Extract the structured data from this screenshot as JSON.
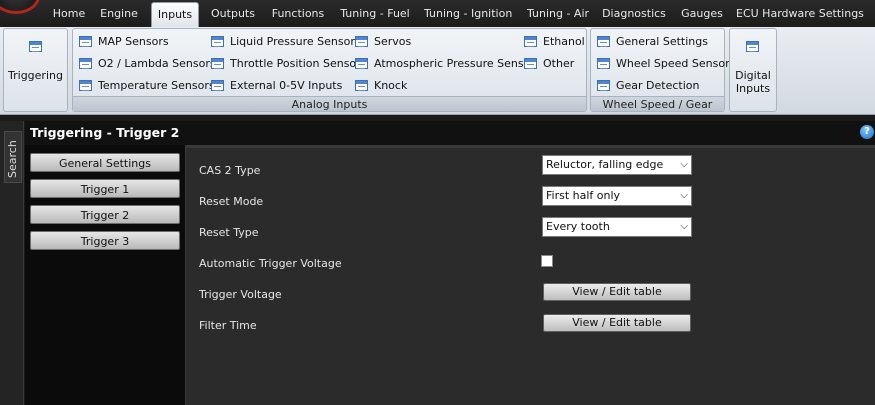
{
  "menu": {
    "tabs": [
      {
        "label": "Home"
      },
      {
        "label": "Engine"
      },
      {
        "label": "Inputs"
      },
      {
        "label": "Outputs"
      },
      {
        "label": "Functions"
      },
      {
        "label": "Tuning - Fuel"
      },
      {
        "label": "Tuning - Ignition"
      },
      {
        "label": "Tuning - Air"
      },
      {
        "label": "Diagnostics"
      },
      {
        "label": "Gauges"
      },
      {
        "label": "ECU Hardware Settings"
      }
    ],
    "active_tab": "Inputs"
  },
  "ribbon": {
    "triggering": {
      "label": "Triggering"
    },
    "analog_inputs": {
      "group_label": "Analog Inputs",
      "items": [
        {
          "label": "MAP Sensors"
        },
        {
          "label": "O2 / Lambda Sensors"
        },
        {
          "label": "Temperature Sensors"
        },
        {
          "label": "Liquid Pressure Sensors"
        },
        {
          "label": "Throttle Position Sensor"
        },
        {
          "label": "External 0-5V Inputs"
        },
        {
          "label": "Servos"
        },
        {
          "label": "Atmospheric Pressure Sensor"
        },
        {
          "label": "Knock"
        },
        {
          "label": "Ethanol"
        },
        {
          "label": "Other"
        }
      ]
    },
    "wheel_speed": {
      "group_label": "Wheel Speed / Gear",
      "items": [
        {
          "label": "General Settings"
        },
        {
          "label": "Wheel Speed Sensor"
        },
        {
          "label": "Gear Detection"
        }
      ]
    },
    "digital_inputs": {
      "label_line1": "Digital",
      "label_line2": "Inputs"
    }
  },
  "sidebar": {
    "search_label": "Search"
  },
  "page": {
    "title": "Triggering - Trigger 2",
    "help": "?"
  },
  "nav": {
    "items": [
      {
        "label": "General Settings"
      },
      {
        "label": "Trigger 1"
      },
      {
        "label": "Trigger 2"
      },
      {
        "label": "Trigger 3"
      }
    ]
  },
  "settings": {
    "cas2_type": {
      "label": "CAS 2 Type",
      "value": "Reluctor, falling edge"
    },
    "reset_mode": {
      "label": "Reset Mode",
      "value": "First half only"
    },
    "reset_type": {
      "label": "Reset Type",
      "value": "Every tooth"
    },
    "auto_trigger_voltage": {
      "label": "Automatic Trigger Voltage",
      "checked": false
    },
    "trigger_voltage": {
      "label": "Trigger Voltage",
      "button": "View / Edit table"
    },
    "filter_time": {
      "label": "Filter Time",
      "button": "View / Edit table"
    }
  },
  "icons": {
    "ribbon_item": "document-list-icon",
    "dropdown": "chevron-down-icon",
    "help": "help-icon"
  }
}
